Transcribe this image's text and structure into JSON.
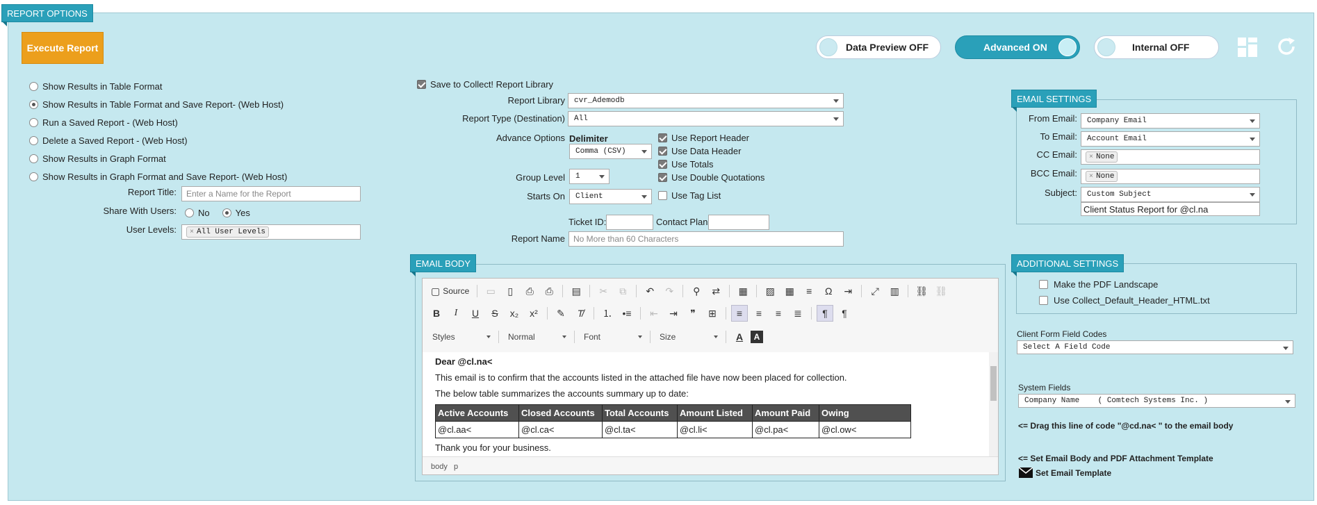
{
  "header": {
    "title": "REPORT OPTIONS"
  },
  "toolbar": {
    "execute_label": "Execute Report",
    "data_preview": "Data Preview OFF",
    "advanced": "Advanced ON",
    "internal": "Internal OFF"
  },
  "output_options": [
    {
      "label": "Show Results in Table Format",
      "selected": false
    },
    {
      "label": "Show Results in Table Format and Save Report- (Web Host)",
      "selected": true
    },
    {
      "label": "Run a Saved Report - (Web Host)",
      "selected": false
    },
    {
      "label": "Delete a Saved Report - (Web Host)",
      "selected": false
    },
    {
      "label": "Show Results in Graph Format",
      "selected": false
    },
    {
      "label": "Show Results in Graph Format and Save Report- (Web Host)",
      "selected": false
    }
  ],
  "report_title": {
    "label": "Report Title:",
    "placeholder": "Enter a Name for the Report"
  },
  "share": {
    "label": "Share With Users:",
    "no": "No",
    "yes": "Yes"
  },
  "user_levels": {
    "label": "User Levels:",
    "chip": "All User Levels"
  },
  "library": {
    "save_label": "Save to Collect! Report Library",
    "report_library_label": "Report Library",
    "report_library_value": "cvr_Ademodb",
    "report_type_label": "Report Type (Destination)",
    "report_type_value": "All",
    "advance_label": "Advance Options",
    "delimiter_label": "Delimiter",
    "delimiter_value": "Comma (CSV)",
    "group_level_label": "Group Level",
    "group_level_value": "1",
    "starts_on_label": "Starts On",
    "starts_on_value": "Client",
    "use_report_header": "Use Report Header",
    "use_data_header": "Use Data Header",
    "use_totals": "Use Totals",
    "use_double_quotations": "Use Double Quotations",
    "use_tag_list": "Use Tag List",
    "ticket_id_label": "Ticket ID:",
    "contact_plan_label": "Contact Plan:",
    "report_name_label": "Report Name",
    "report_name_placeholder": "No More than 60 Characters"
  },
  "email_body": {
    "title": "EMAIL BODY",
    "source_label": "Source",
    "styles": "Styles",
    "format": "Normal",
    "font": "Font",
    "size": "Size",
    "greeting": "Dear @cl.na<",
    "line1": "This email is to confirm that the accounts listed in the attached file have now been placed for collection.",
    "line2": "The below table summarizes the accounts summary up to date:",
    "table_headers": [
      "Active Accounts",
      "Closed Accounts",
      "Total Accounts",
      "Amount Listed",
      "Amount Paid",
      "Owing"
    ],
    "table_row": [
      "@cl.aa<",
      "@cl.ca<",
      "@cl.ta<",
      "@cl.li<",
      "@cl.pa<",
      "@cl.ow<"
    ],
    "line3": "Thank you for your business.",
    "status_body": "body",
    "status_p": "p"
  },
  "email_settings": {
    "title": "EMAIL SETTINGS",
    "from_label": "From Email:",
    "from_value": "Company Email",
    "to_label": "To Email:",
    "to_value": "Account Email",
    "cc_label": "CC Email:",
    "cc_chip": "None",
    "bcc_label": "BCC Email:",
    "bcc_chip": "None",
    "subject_label": "Subject:",
    "subject_select": "Custom Subject",
    "subject_value": "Client Status Report for @cl.na"
  },
  "additional_settings": {
    "title": "ADDITIONAL SETTINGS",
    "pdf_landscape": "Make the PDF Landscape",
    "default_header": "Use Collect_Default_Header_HTML.txt"
  },
  "field_codes": {
    "client_label": "Client Form Field Codes",
    "client_value": "Select A Field Code",
    "system_label": "System Fields",
    "system_value": "Company Name    ( Comtech Systems Inc. )",
    "drag_hint": "<= Drag this line of code \"@cd.na< \" to the email body",
    "template_hint": "<= Set Email Body and PDF Attachment Template",
    "set_template": "Set Email Template"
  }
}
